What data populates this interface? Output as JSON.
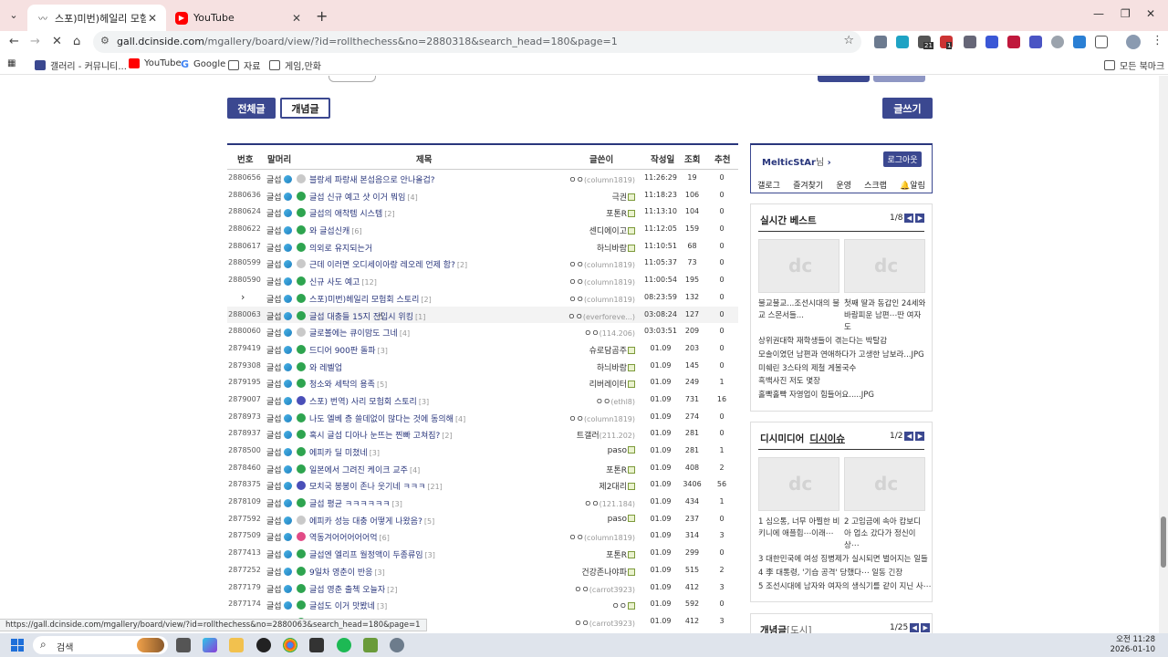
{
  "browser": {
    "tabs": [
      {
        "title": "스포)미번)헤일리 모험회 스토",
        "active": true,
        "icon": "dc-icon"
      },
      {
        "title": "YouTube",
        "active": false,
        "icon": "youtube-icon"
      }
    ],
    "url_host": "gall.dcinside.com",
    "url_path": "/mgallery/board/view/?id=rollthechess&no=2880318&search_head=180&page=1",
    "bookmarks": [
      "갤러리 - 커뮤니티...",
      "YouTube",
      "Google",
      "자료",
      "게임,만화"
    ],
    "all_bookmarks": "모든 북마크",
    "status_url": "https://gall.dcinside.com/mgallery/board/view/?id=rollthechess&no=2880063&search_head=180&page=1",
    "extension_badge_1": "21",
    "extension_badge_2": "1"
  },
  "board": {
    "buttons": {
      "all": "전체글",
      "concept": "개념글",
      "write": "글쓰기"
    },
    "columns": {
      "no": "번호",
      "head": "말머리",
      "title": "제목",
      "writer": "글쓴이",
      "date": "작성일",
      "views": "조회",
      "recommend": "추천"
    },
    "rows": [
      {
        "no": "2880656",
        "head": "글섭",
        "icon": "txt",
        "title": "블랑세 파랑새 본섭음으로 안나올겁?",
        "cnt": "",
        "writer": "ㅇㅇ",
        "ip": "(column1819)",
        "date": "11:26:29",
        "views": "19",
        "rec": "0"
      },
      {
        "no": "2880636",
        "head": "글섭",
        "icon": "pic",
        "title": "글섭 신규 예고 샷 이거 뭐임",
        "cnt": "[4]",
        "writer": "극권",
        "ip": "",
        "date": "11:18:23",
        "views": "106",
        "rec": "0"
      },
      {
        "no": "2880624",
        "head": "글섭",
        "icon": "pic",
        "title": "글섭의 애착템 시스템",
        "cnt": "[2]",
        "writer": "포톤R",
        "ip": "",
        "date": "11:13:10",
        "views": "104",
        "rec": "0"
      },
      {
        "no": "2880622",
        "head": "글섭",
        "icon": "pic",
        "title": "와 글섭신캐",
        "cnt": "[6]",
        "writer": "센디에이고",
        "ip": "",
        "date": "11:12:05",
        "views": "159",
        "rec": "0"
      },
      {
        "no": "2880617",
        "head": "글섭",
        "icon": "pic",
        "title": "의외로 유지되는거",
        "cnt": "",
        "writer": "하늬바람",
        "ip": "",
        "date": "11:10:51",
        "views": "68",
        "rec": "0"
      },
      {
        "no": "2880599",
        "head": "글섭",
        "icon": "txt",
        "title": "근데 이러면 오디세이아랑 레오레 언제 함?",
        "cnt": "[2]",
        "writer": "ㅇㅇ",
        "ip": "(column1819)",
        "date": "11:05:37",
        "views": "73",
        "rec": "0"
      },
      {
        "no": "2880590",
        "head": "글섭",
        "icon": "pic",
        "title": "신규 사도 예고",
        "cnt": "[12]",
        "writer": "ㅇㅇ",
        "ip": "(column1819)",
        "date": "11:00:54",
        "views": "195",
        "rec": "0"
      },
      {
        "no": "",
        "head": "글섭",
        "icon": "pic",
        "title": "스포)미번)헤일리 모험회 스토리",
        "cnt": "[2]",
        "writer": "ㅇㅇ",
        "ip": "(column1819)",
        "date": "08:23:59",
        "views": "132",
        "rec": "0",
        "current": true
      },
      {
        "no": "2880063",
        "head": "글섭",
        "icon": "pic",
        "title": "글섭 대충들 15지 진입시 위킹",
        "cnt": "[1]",
        "writer": "ㅇㅇ",
        "ip": "(everforeve...)",
        "date": "03:08:24",
        "views": "127",
        "rec": "0",
        "hover": true
      },
      {
        "no": "2880060",
        "head": "글섭",
        "icon": "txt",
        "title": "글로볼에는 큐이맘도 그네",
        "cnt": "[4]",
        "writer": "ㅇㅇ",
        "ip": "(114.206)",
        "date": "03:03:51",
        "views": "209",
        "rec": "0"
      },
      {
        "no": "2879419",
        "head": "글섭",
        "icon": "pic",
        "title": "드디어 900판 돌파",
        "cnt": "[3]",
        "writer": "슈로담곰주",
        "ip": "",
        "date": "01.09",
        "views": "203",
        "rec": "0"
      },
      {
        "no": "2879308",
        "head": "글섭",
        "icon": "pic",
        "title": "와 레벨업",
        "cnt": "",
        "writer": "하늬바람",
        "ip": "",
        "date": "01.09",
        "views": "145",
        "rec": "0"
      },
      {
        "no": "2879195",
        "head": "글섭",
        "icon": "pic",
        "title": "청소와 세탁의 용족",
        "cnt": "[5]",
        "writer": "리버레이터",
        "ip": "",
        "date": "01.09",
        "views": "249",
        "rec": "1"
      },
      {
        "no": "2879007",
        "head": "글섭",
        "icon": "rec",
        "title": "스포) 번역) 사리 모험회 스토리",
        "cnt": "[3]",
        "writer": "ㅇㅇ",
        "ip": "(ethl8)",
        "date": "01.09",
        "views": "731",
        "rec": "16"
      },
      {
        "no": "2878973",
        "head": "글섭",
        "icon": "pic",
        "title": "나도 엘베 층 쓸데없이 많다는 것에 동의해",
        "cnt": "[4]",
        "writer": "ㅇㅇ",
        "ip": "(column1819)",
        "date": "01.09",
        "views": "274",
        "rec": "0"
      },
      {
        "no": "2878937",
        "head": "글섭",
        "icon": "pic",
        "title": "혹시 글섭 디아나 눈뜨는 찐빠 고쳐짐?",
        "cnt": "[2]",
        "writer": "트갤러",
        "ip": "(211.202)",
        "date": "01.09",
        "views": "281",
        "rec": "0"
      },
      {
        "no": "2878500",
        "head": "글섭",
        "icon": "pic",
        "title": "에피카 딜 미쳤네",
        "cnt": "[3]",
        "writer": "paso",
        "ip": "",
        "date": "01.09",
        "views": "281",
        "rec": "1"
      },
      {
        "no": "2878460",
        "head": "글섭",
        "icon": "pic",
        "title": "일본에서 그려진 케이크 교주",
        "cnt": "[4]",
        "writer": "포톤R",
        "ip": "",
        "date": "01.09",
        "views": "408",
        "rec": "2"
      },
      {
        "no": "2878375",
        "head": "글섭",
        "icon": "rec",
        "title": "모치국 봉봉이 존나 웃기네 ㅋㅋㅋ",
        "cnt": "[21]",
        "writer": "제2대리",
        "ip": "",
        "date": "01.09",
        "views": "3406",
        "rec": "56"
      },
      {
        "no": "2878109",
        "head": "글섭",
        "icon": "pic",
        "title": "글섭 평균 ㅋㅋㅋㅋㅋㅋ",
        "cnt": "[3]",
        "writer": "ㅇㅇ",
        "ip": "(121.184)",
        "date": "01.09",
        "views": "434",
        "rec": "1"
      },
      {
        "no": "2877592",
        "head": "글섭",
        "icon": "txt",
        "title": "에피카 성능 대충 어떻게 나왔음?",
        "cnt": "[5]",
        "writer": "paso",
        "ip": "",
        "date": "01.09",
        "views": "237",
        "rec": "0"
      },
      {
        "no": "2877509",
        "head": "글섭",
        "icon": "vid",
        "title": "역동겨어어어어어억",
        "cnt": "[6]",
        "writer": "ㅇㅇ",
        "ip": "(column1819)",
        "date": "01.09",
        "views": "314",
        "rec": "3"
      },
      {
        "no": "2877413",
        "head": "글섭",
        "icon": "pic",
        "title": "글섭엔 엘리프 월정액이 두종류임",
        "cnt": "[3]",
        "writer": "포톤R",
        "ip": "",
        "date": "01.09",
        "views": "299",
        "rec": "0"
      },
      {
        "no": "2877252",
        "head": "글섭",
        "icon": "pic",
        "title": "9일차 영춘이 반응",
        "cnt": "[3]",
        "writer": "건강존나야파",
        "ip": "",
        "date": "01.09",
        "views": "515",
        "rec": "2"
      },
      {
        "no": "2877179",
        "head": "글섭",
        "icon": "pic",
        "title": "글섭 영춘 출첵 오늘자",
        "cnt": "[2]",
        "writer": "ㅇㅇ",
        "ip": "(carrot3923)",
        "date": "01.09",
        "views": "412",
        "rec": "3"
      },
      {
        "no": "2877174",
        "head": "글섭",
        "icon": "pic",
        "title": "글섭도 이거 맛봤네",
        "cnt": "[3]",
        "writer": "ㅇㅇ",
        "ip": "",
        "date": "01.09",
        "views": "592",
        "rec": "0"
      },
      {
        "no": "",
        "head": "글섭",
        "icon": "pic",
        "title": "글섭 그리고 이거 넘 귀엽다",
        "cnt": "[3]",
        "writer": "ㅇㅇ",
        "ip": "(carrot3923)",
        "date": "01.09",
        "views": "412",
        "rec": "3"
      }
    ]
  },
  "sidebar": {
    "user": {
      "nick": "MelticStAr",
      "suffix": "님",
      "logout": "로그아웃",
      "links": [
        "갤로그",
        "즐겨찾기",
        "운영",
        "스크랩",
        "알림"
      ]
    },
    "best": {
      "title": "실시간 베스트",
      "page": "1/8",
      "captions": [
        "불교불교...조선시대의 불교 스몬서들...",
        "첫째 딸과 동갑인 24세와 바람피운 남편⋯딴 여자도"
      ],
      "items": [
        "상위권대학 재학생들이 겪는다는 박탈감",
        "모솔이였던 남편과 연애하다가 고생한 남보라...JPG",
        "미쉐린 3스타의 제철 게볼국수",
        "흑백사진 저도 몇장",
        "홀빡홀빡 자영업이 힘들어요.....JPG"
      ]
    },
    "media": {
      "title": "디시미디어",
      "sub": "디시이슈",
      "page": "1/2",
      "captions": [
        "1  심으통, 너무 아찔한 비키니에 애플힙⋯이래⋯",
        "2  고임금에 속아 캄보디아 업소 갔다가 정신이상⋯"
      ],
      "items": [
        "3  대한민국에 여성 징병제가 실시되면 벌어지는 일들",
        "4  李 대통령, '기습 공격' 당했다⋯ 일동 긴장",
        "5  조선시대에 남자와 여자의 생식기를 같이 지닌 사⋯"
      ]
    },
    "concept": {
      "title": "개념글",
      "sub": "[도시]",
      "page": "1/25"
    }
  },
  "taskbar": {
    "search": "검색",
    "time": "오전 11:28",
    "date": "2026-01-10"
  }
}
